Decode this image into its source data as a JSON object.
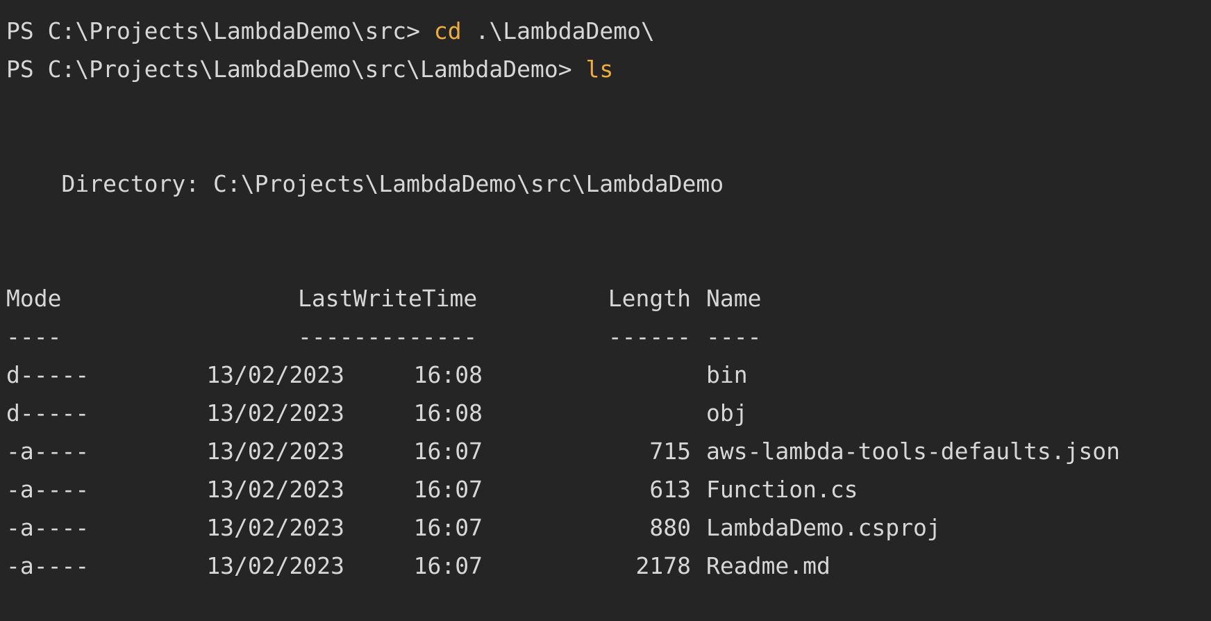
{
  "terminal": {
    "prompt1": "PS C:\\Projects\\LambdaDemo\\src> ",
    "cmd1": "cd",
    "arg1": " .\\LambdaDemo\\",
    "prompt2": "PS C:\\Projects\\LambdaDemo\\src\\LambdaDemo> ",
    "cmd2": "ls",
    "directory": "    Directory: C:\\Projects\\LambdaDemo\\src\\LambdaDemo",
    "headers": {
      "mode": "Mode",
      "lastwritetime": "LastWriteTime",
      "length": "Length",
      "name": "Name"
    },
    "separators": {
      "mode": "----",
      "lastwritetime": "-------------",
      "length": "------",
      "name": "----"
    },
    "rows": [
      {
        "mode": "d-----",
        "date": "13/02/2023",
        "time": "16:08",
        "length": "",
        "name": "bin"
      },
      {
        "mode": "d-----",
        "date": "13/02/2023",
        "time": "16:08",
        "length": "",
        "name": "obj"
      },
      {
        "mode": "-a----",
        "date": "13/02/2023",
        "time": "16:07",
        "length": "715",
        "name": "aws-lambda-tools-defaults.json"
      },
      {
        "mode": "-a----",
        "date": "13/02/2023",
        "time": "16:07",
        "length": "613",
        "name": "Function.cs"
      },
      {
        "mode": "-a----",
        "date": "13/02/2023",
        "time": "16:07",
        "length": "880",
        "name": "LambdaDemo.csproj"
      },
      {
        "mode": "-a----",
        "date": "13/02/2023",
        "time": "16:07",
        "length": "2178",
        "name": "Readme.md"
      }
    ],
    "colors": {
      "background": "#252525",
      "text": "#d7d7d7",
      "command": "#f0ad3a"
    }
  }
}
